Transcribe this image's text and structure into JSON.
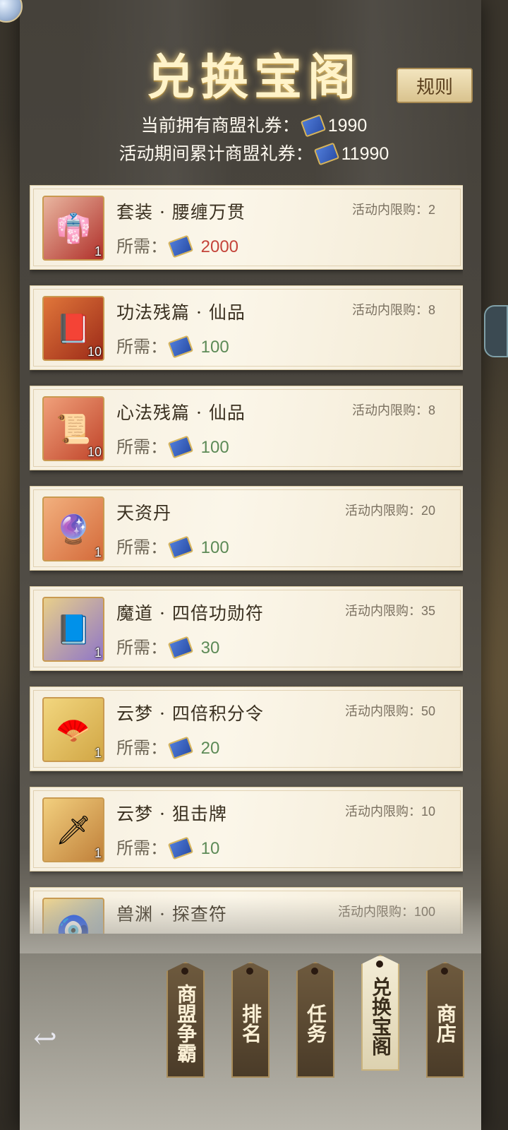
{
  "header": {
    "title": "兑换宝阁",
    "rules_label": "规则",
    "owned_label": "当前拥有商盟礼券：",
    "owned_value": "1990",
    "accum_label": "活动期间累计商盟礼券：",
    "accum_value": "11990"
  },
  "items": [
    {
      "name": "套装 · 腰缠万贯",
      "limit_label": "活动内限购：",
      "limit": "2",
      "price_label": "所需：",
      "price": "2000",
      "count": "1",
      "icon": "outfit-icon",
      "price_color": "red"
    },
    {
      "name": "功法残篇 · 仙品",
      "limit_label": "活动内限购：",
      "limit": "8",
      "price_label": "所需：",
      "price": "100",
      "count": "10",
      "icon": "scroll-book-icon",
      "price_color": "green"
    },
    {
      "name": "心法残篇 · 仙品",
      "limit_label": "活动内限购：",
      "limit": "8",
      "price_label": "所需：",
      "price": "100",
      "count": "10",
      "icon": "scroll-icon",
      "price_color": "green"
    },
    {
      "name": "天资丹",
      "limit_label": "活动内限购：",
      "limit": "20",
      "price_label": "所需：",
      "price": "100",
      "count": "1",
      "icon": "pill-icon",
      "price_color": "green"
    },
    {
      "name": "魔道 · 四倍功勋符",
      "limit_label": "活动内限购：",
      "limit": "35",
      "price_label": "所需：",
      "price": "30",
      "count": "1",
      "icon": "talisman-icon",
      "price_color": "green"
    },
    {
      "name": "云梦 · 四倍积分令",
      "limit_label": "活动内限购：",
      "limit": "50",
      "price_label": "所需：",
      "price": "20",
      "count": "1",
      "icon": "fan-token-icon",
      "price_color": "green"
    },
    {
      "name": "云梦 · 狙击牌",
      "limit_label": "活动内限购：",
      "limit": "10",
      "price_label": "所需：",
      "price": "10",
      "count": "1",
      "icon": "sword-plate-icon",
      "price_color": "green"
    },
    {
      "name": "兽渊 · 探查符",
      "limit_label": "活动内限购：",
      "limit": "100",
      "price_label": "",
      "price": "",
      "count": "",
      "icon": "probe-charm-icon",
      "price_color": "green"
    }
  ],
  "nav_tabs": [
    {
      "label": "商盟争霸",
      "active": false
    },
    {
      "label": "排名",
      "active": false
    },
    {
      "label": "任务",
      "active": false
    },
    {
      "label": "兑换宝阁",
      "active": true
    },
    {
      "label": "商店",
      "active": false
    }
  ],
  "colors": {
    "price_red": "#c4443a",
    "price_green": "#5c8a56",
    "title_gold": "#fff3c9"
  }
}
